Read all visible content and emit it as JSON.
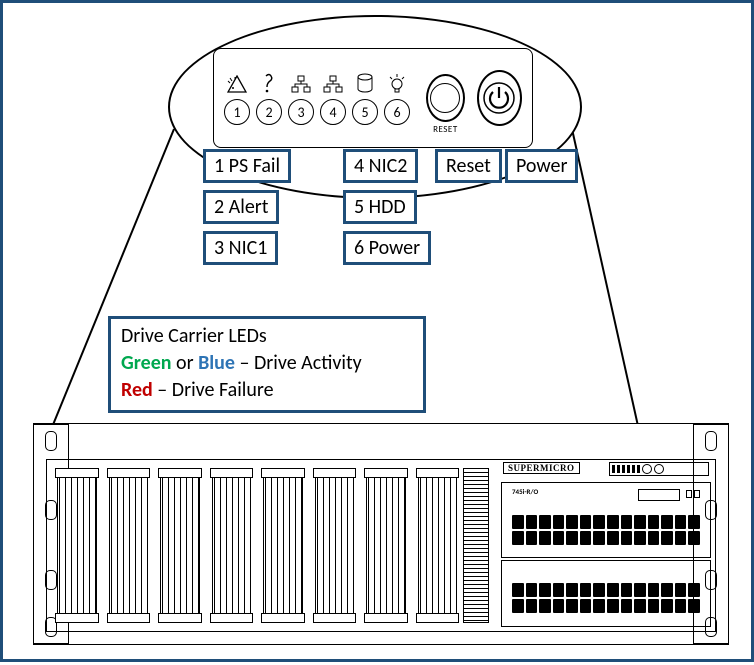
{
  "panel": {
    "leds": [
      {
        "num": "1",
        "name": "PS Fail",
        "icon": "warn-icon"
      },
      {
        "num": "2",
        "name": "Alert",
        "icon": "info-icon"
      },
      {
        "num": "3",
        "name": "NIC1",
        "icon": "net-icon"
      },
      {
        "num": "4",
        "name": "NIC2",
        "icon": "net-icon"
      },
      {
        "num": "5",
        "name": "HDD",
        "icon": "disk-icon"
      },
      {
        "num": "6",
        "name": "Power",
        "icon": "bulb-icon"
      }
    ],
    "buttons": {
      "reset": "Reset",
      "reset_caption": "RESET",
      "power": "Power"
    }
  },
  "labels": {
    "l1": "1 PS Fail",
    "l2": "2 Alert",
    "l3": "3 NIC1",
    "l4": "4 NIC2",
    "l5": "5 HDD",
    "l6": "6 Power",
    "lreset": "Reset",
    "lpower": "Power"
  },
  "legend": {
    "title": "Drive Carrier LEDs",
    "line2_a": "Green",
    "line2_or": " or ",
    "line2_b": "Blue",
    "line2_rest": " – Drive Activity",
    "line3_a": "Red",
    "line3_rest": " – Drive Failure"
  },
  "chassis": {
    "brand": "SUPERMICRO",
    "module_label": "745i-R/O"
  }
}
